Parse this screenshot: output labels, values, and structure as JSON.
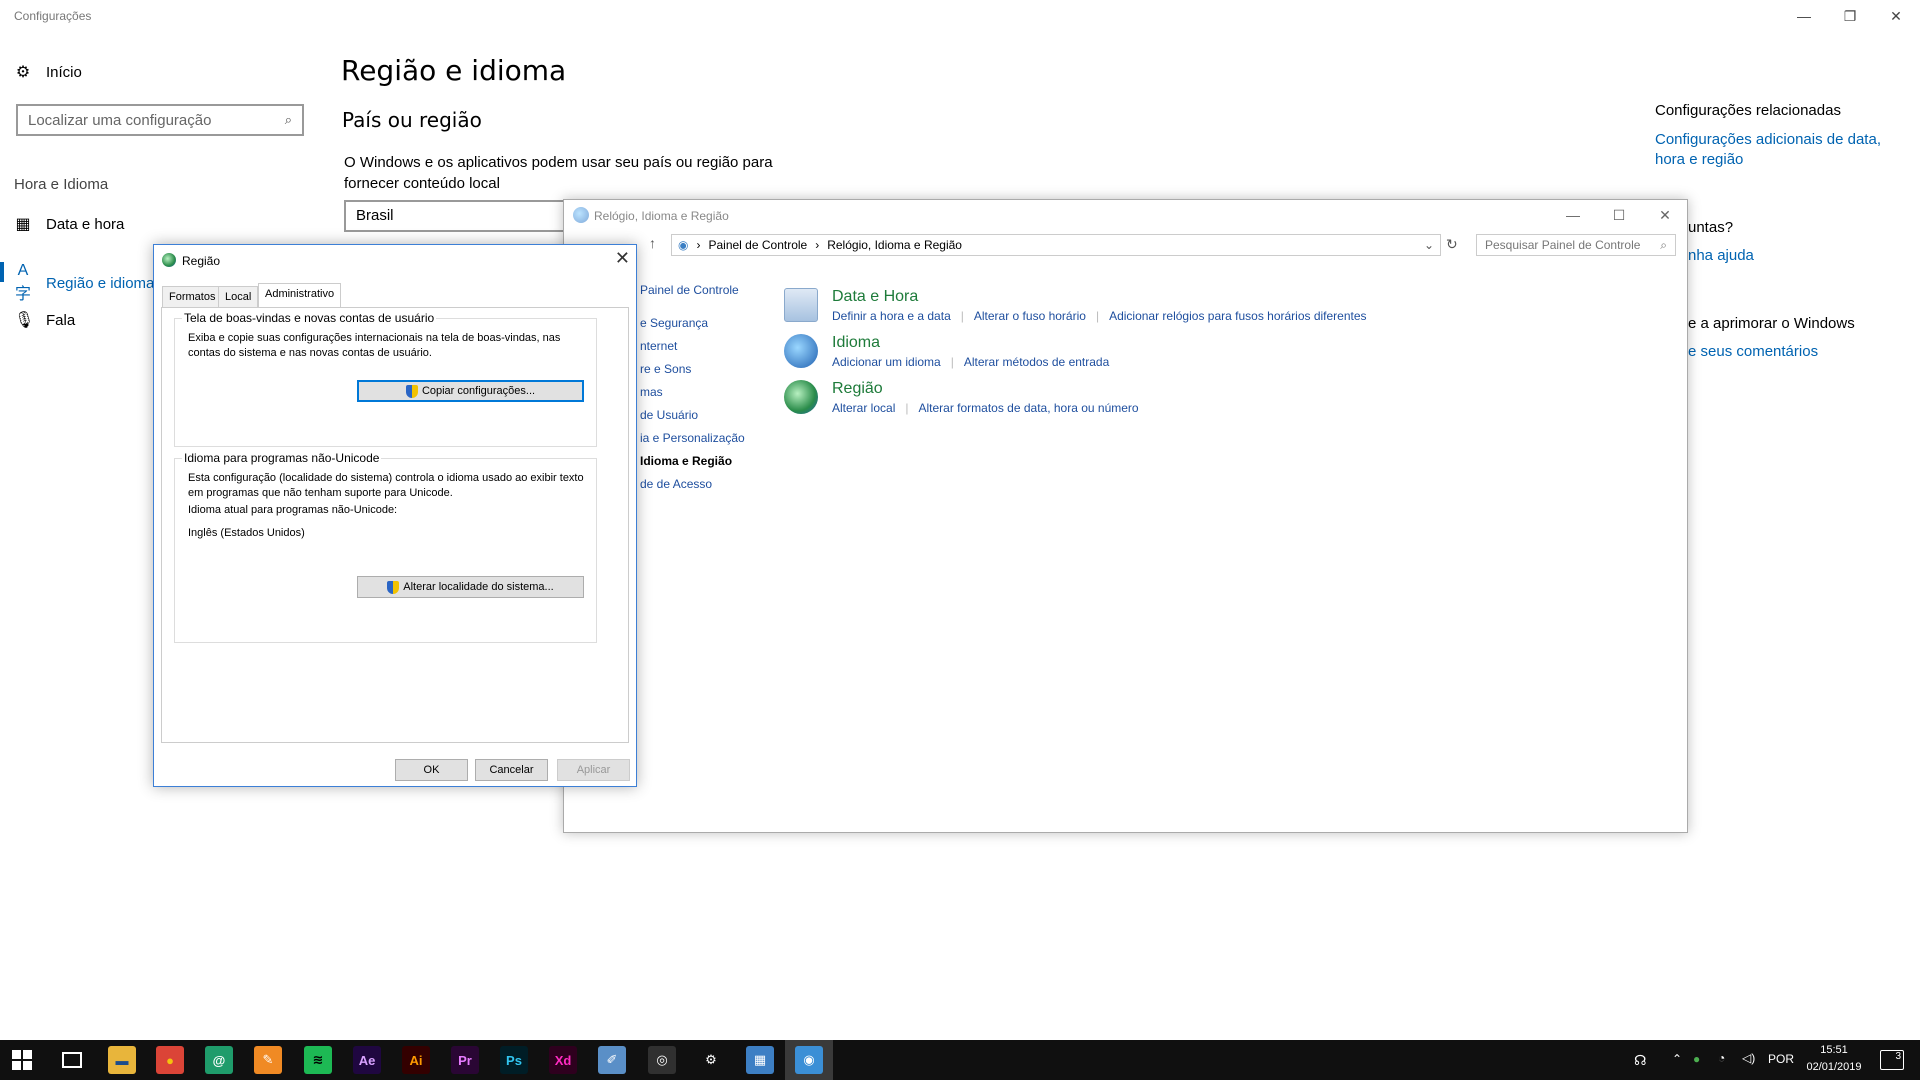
{
  "settings": {
    "window_title": "Configurações",
    "controls": {
      "minimize": "—",
      "restore": "❐",
      "close": "✕"
    },
    "home_label": "Início",
    "search_placeholder": "Localizar uma configuração",
    "section_label": "Hora e Idioma",
    "nav": [
      {
        "label": "Data e hora",
        "icon": "calendar-clock-icon"
      },
      {
        "label": "Região e idioma",
        "icon": "region-language-icon"
      },
      {
        "label": "Fala",
        "icon": "microphone-icon"
      }
    ],
    "page_title": "Região e idioma",
    "section_title": "País ou região",
    "description": "O Windows e os aplicativos podem usar seu país ou região para fornecer conteúdo local",
    "country_value": "Brasil",
    "related_title": "Configurações relacionadas",
    "related_link": "Configurações adicionais de data, hora e região",
    "partial_question": "untas?",
    "partial_help": "nha ajuda",
    "partial_improve": "e a aprimorar o Windows",
    "partial_feedback": "e seus comentários"
  },
  "control_panel": {
    "window_title": "Relógio, Idioma e Região",
    "breadcrumb": [
      "Painel de Controle",
      "Relógio, Idioma e Região"
    ],
    "search_placeholder": "Pesquisar Painel de Controle",
    "sidebar": [
      "Painel de Controle",
      "e Segurança",
      "nternet",
      "re e Sons",
      "mas",
      "de Usuário",
      "ia e Personalização",
      "Idioma e Região",
      "de de Acesso"
    ],
    "categories": [
      {
        "title": "Data e Hora",
        "links": [
          "Definir a hora e a data",
          "Alterar o fuso horário",
          "Adicionar relógios para fusos horários diferentes"
        ]
      },
      {
        "title": "Idioma",
        "links": [
          "Adicionar um idioma",
          "Alterar métodos de entrada"
        ]
      },
      {
        "title": "Região",
        "links": [
          "Alterar local",
          "Alterar formatos de data, hora ou número"
        ]
      }
    ]
  },
  "region_dialog": {
    "title": "Região",
    "tabs": [
      "Formatos",
      "Local",
      "Administrativo"
    ],
    "welcome_group": {
      "label": "Tela de boas-vindas e novas contas de usuário",
      "text": "Exiba e copie suas configurações internacionais na tela de boas-vindas, nas contas do sistema e nas novas contas de usuário.",
      "button": "Copiar configurações..."
    },
    "unicode_group": {
      "label": "Idioma para programas não-Unicode",
      "text": "Esta configuração (localidade do sistema) controla o idioma usado ao exibir texto em programas que não tenham suporte para Unicode.",
      "current_label": "Idioma atual para programas não-Unicode:",
      "current_value": "Inglês (Estados Unidos)",
      "button": "Alterar localidade do sistema..."
    },
    "ok": "OK",
    "cancel": "Cancelar",
    "apply": "Aplicar"
  },
  "taskbar": {
    "apps": [
      {
        "name": "file-explorer-icon",
        "glyph": "▬",
        "bg": "#e8b53b",
        "fg": "#1c4d8c"
      },
      {
        "name": "chrome-icon",
        "glyph": "●",
        "bg": "#db4437",
        "fg": "#f4c20d"
      },
      {
        "name": "app-green-icon",
        "glyph": "@",
        "bg": "#1f9c6b",
        "fg": "#ffffff"
      },
      {
        "name": "app-orange-icon",
        "glyph": "✎",
        "bg": "#f08a24",
        "fg": "#ffffff"
      },
      {
        "name": "spotify-icon",
        "glyph": "≋",
        "bg": "#1db954",
        "fg": "#000000"
      },
      {
        "name": "after-effects-icon",
        "glyph": "Ae",
        "bg": "#1f0740",
        "fg": "#d8a1ff"
      },
      {
        "name": "illustrator-icon",
        "glyph": "Ai",
        "bg": "#330000",
        "fg": "#ff9a00"
      },
      {
        "name": "premiere-icon",
        "glyph": "Pr",
        "bg": "#2a0634",
        "fg": "#e77bff"
      },
      {
        "name": "photoshop-icon",
        "glyph": "Ps",
        "bg": "#001d26",
        "fg": "#31c5f0"
      },
      {
        "name": "xd-icon",
        "glyph": "Xd",
        "bg": "#2e001e",
        "fg": "#ff2bc2"
      },
      {
        "name": "notepad-icon",
        "glyph": "✐",
        "bg": "#5a8fc7",
        "fg": "#ffffff"
      },
      {
        "name": "obs-icon",
        "glyph": "◎",
        "bg": "#303030",
        "fg": "#ffffff"
      },
      {
        "name": "settings-icon",
        "glyph": "⚙",
        "bg": "#101010",
        "fg": "#ffffff"
      },
      {
        "name": "control-panel-icon",
        "glyph": "▦",
        "bg": "#3d7fc4",
        "fg": "#ffffff"
      },
      {
        "name": "region-globe-icon",
        "glyph": "◉",
        "bg": "#3b8fd6",
        "fg": "#ffffff"
      }
    ],
    "lang": "POR",
    "time": "15:51",
    "date": "02/01/2019",
    "notifications": "3"
  }
}
